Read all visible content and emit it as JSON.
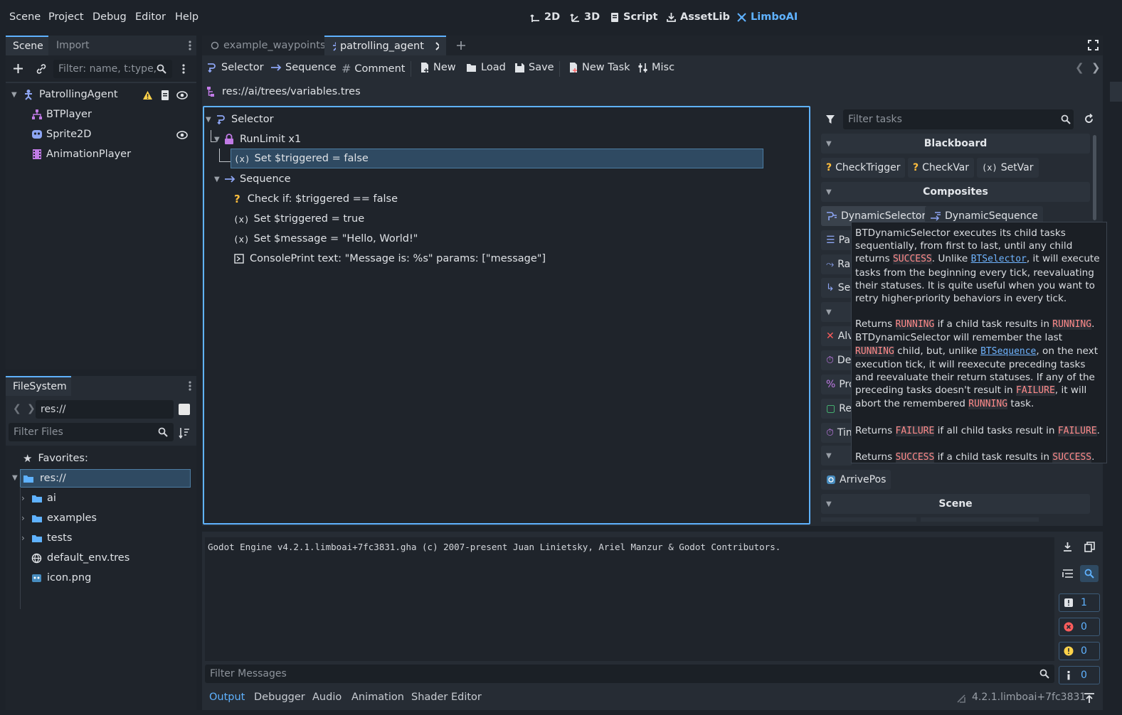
{
  "menu": [
    "Scene",
    "Project",
    "Debug",
    "Editor",
    "Help"
  ],
  "workspaces": [
    {
      "label": "2D",
      "icon": "2d-icon"
    },
    {
      "label": "3D",
      "icon": "3d-icon"
    },
    {
      "label": "Script",
      "icon": "script-icon"
    },
    {
      "label": "AssetLib",
      "icon": "assetlib-icon"
    },
    {
      "label": "LimboAI",
      "icon": "limboai-icon",
      "active": true
    }
  ],
  "scene_dock": {
    "tabs": [
      "Scene",
      "Import"
    ],
    "filter_placeholder": "Filter: name, t:type,",
    "nodes": [
      "PatrollingAgent",
      "BTPlayer",
      "Sprite2D",
      "AnimationPlayer"
    ]
  },
  "filesystem_dock": {
    "tab": "FileSystem",
    "path": "res://",
    "filter_placeholder": "Filter Files",
    "favorites_label": "Favorites:",
    "root": "res://",
    "items": [
      "ai",
      "examples",
      "tests",
      "default_env.tres",
      "icon.png"
    ]
  },
  "editor_tabs": [
    "example_waypoints",
    "patrolling_agent"
  ],
  "limbo_toolbar": {
    "selector": "Selector",
    "sequence": "Sequence",
    "comment": "Comment",
    "new": "New",
    "load": "Load",
    "save": "Save",
    "new_task": "New Task",
    "misc": "Misc"
  },
  "resource_path": "res://ai/trees/variables.tres",
  "bt_tree": [
    "Selector",
    "RunLimit x1",
    "Set $triggered = false",
    "Sequence",
    "Check if: $triggered == false",
    "Set $triggered = true",
    "Set $message = \"Hello, World!\"",
    "ConsolePrint  text: \"Message is: %s\"  params: [\"message\"]"
  ],
  "task_panel": {
    "filter_placeholder": "Filter tasks",
    "sections": [
      "Blackboard",
      "Composites",
      "Scene"
    ],
    "blackboard": [
      "CheckTrigger",
      "CheckVar",
      "SetVar"
    ],
    "composites": [
      "DynamicSelector",
      "DynamicSequence"
    ],
    "partial_items": [
      "Pa",
      "Ra",
      "Se",
      "Alv",
      "De",
      "Pro",
      "Re",
      "Tin"
    ],
    "arrive": "ArrivePos"
  },
  "tooltip": {
    "p1": [
      "BTDynamicSelector executes its child tasks sequentially, from first to last, until any child returns ",
      "SUCCESS",
      ". Unlike ",
      "BTSelector",
      ", it will execute tasks from the beginning every tick, reevaluating their statuses. It is quite useful when you want to retry higher-priority behaviors in every tick."
    ],
    "p2": [
      "Returns ",
      "RUNNING",
      " if a child task results in ",
      "RUNNING",
      ". BTDynamicSelector will remember the last ",
      "RUNNING",
      " child, but, unlike ",
      "BTSequence",
      ", on the next execution tick, it will reexecute preceding tasks and reevaluate their return statuses. If any of the preceding tasks doesn't result in ",
      "FAILURE",
      ", it will abort the remembered ",
      "RUNNING",
      " task."
    ],
    "p3": [
      "Returns ",
      "FAILURE",
      " if all child tasks result in ",
      "FAILURE",
      "."
    ],
    "p4": [
      "Returns ",
      "SUCCESS",
      " if a child task results in ",
      "SUCCESS",
      "."
    ]
  },
  "output": {
    "log": "Godot Engine v4.2.1.limboai+7fc3831.gha (c) 2007-present Juan Linietsky, Ariel Manzur & Godot Contributors.",
    "filter_placeholder": "Filter Messages",
    "counts": {
      "messages": "1",
      "errors": "0",
      "warnings": "0",
      "info": "0"
    }
  },
  "bottom_tabs": [
    "Output",
    "Debugger",
    "Audio",
    "Animation",
    "Shader Editor"
  ],
  "version": "4.2.1.limboai+7fc3831",
  "colors": {
    "accent": "#5fb2ff",
    "keyword": "#ff8a8a",
    "warning": "#ffd24a",
    "error": "#ff5c5c"
  }
}
